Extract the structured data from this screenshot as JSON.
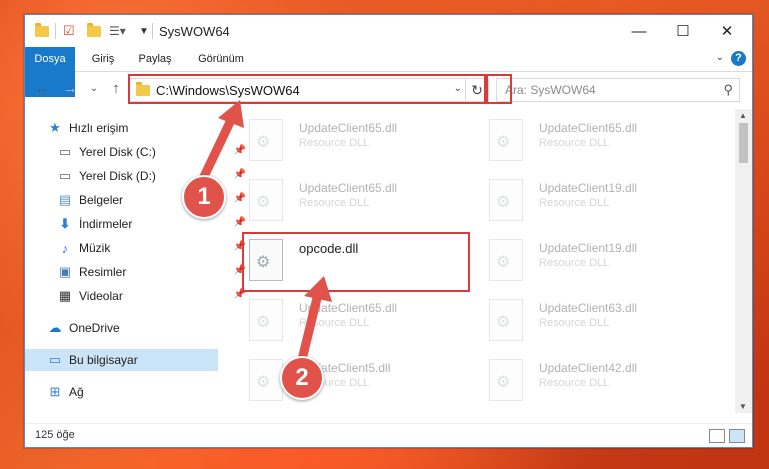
{
  "window": {
    "title": "SysWOW64"
  },
  "ribbon": {
    "tabs": [
      "Dosya",
      "Giriş",
      "Paylaş",
      "Görünüm"
    ],
    "help": "?"
  },
  "address": {
    "path": "C:\\Windows\\SysWOW64"
  },
  "search": {
    "placeholder": "Ara: SysWOW64"
  },
  "nav": {
    "items": [
      {
        "label": "Hızlı erişim",
        "icon": "star-icon"
      },
      {
        "label": "Yerel Disk (C:)",
        "icon": "drive-icon"
      },
      {
        "label": "Yerel Disk (D:)",
        "icon": "drive-icon"
      },
      {
        "label": "Belgeler",
        "icon": "documents-icon"
      },
      {
        "label": "İndirmeler",
        "icon": "downloads-icon"
      },
      {
        "label": "Müzik",
        "icon": "music-icon"
      },
      {
        "label": "Resimler",
        "icon": "pictures-icon"
      },
      {
        "label": "Videolar",
        "icon": "videos-icon"
      },
      {
        "label": "OneDrive",
        "icon": "cloud-icon"
      },
      {
        "label": "Bu bilgisayar",
        "icon": "computer-icon"
      },
      {
        "label": "Ağ",
        "icon": "network-icon"
      }
    ]
  },
  "files": {
    "left": [
      {
        "name": "UpdateClient65.dll",
        "type": "Resource DLL"
      },
      {
        "name": "UpdateClient65.dll",
        "type": "Resource DLL"
      },
      {
        "name": "opcode.dll",
        "type": ""
      },
      {
        "name": "UpdateClient65.dll",
        "type": "Resource DLL"
      },
      {
        "name": "UpdateClient5.dll",
        "type": "Resource DLL"
      }
    ],
    "right": [
      {
        "name": "UpdateClient65.dll",
        "type": "Resource DLL"
      },
      {
        "name": "UpdateClient19.dll",
        "type": "Resource DLL"
      },
      {
        "name": "UpdateClient19.dll",
        "type": "Resource DLL"
      },
      {
        "name": "UpdateClient63.dll",
        "type": "Resource DLL"
      },
      {
        "name": "UpdateClient42.dll",
        "type": "Resource DLL"
      }
    ]
  },
  "status": {
    "count": "125 öğe"
  },
  "annotations": {
    "step1": "1",
    "step2": "2"
  },
  "colors": {
    "accent": "#1979ca",
    "highlight": "#d93a3a",
    "badge": "#e0524a"
  }
}
